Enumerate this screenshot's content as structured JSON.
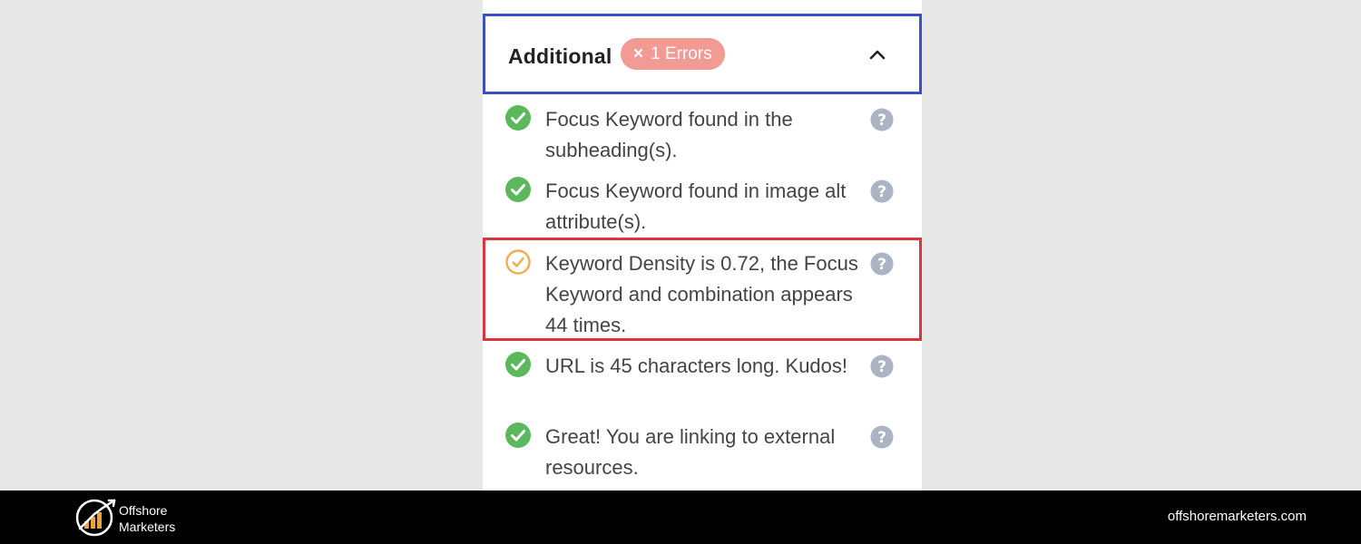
{
  "section": {
    "title": "Additional",
    "badge_x": "×",
    "badge_text": "1 Errors",
    "chevron_icon": "chevron-up-icon"
  },
  "checks": [
    {
      "status": "pass",
      "text": "Focus Keyword found in the subheading(s)."
    },
    {
      "status": "pass",
      "text": "Focus Keyword found in image alt attribute(s)."
    },
    {
      "status": "warning",
      "text": "Keyword Density is 0.72, the Focus Keyword and combination appears 44 times."
    },
    {
      "status": "pass",
      "text": "URL is 45 characters long. Kudos!"
    },
    {
      "status": "pass",
      "text": "Great! You are linking to external resources."
    }
  ],
  "colors": {
    "pass": "#5cb85c",
    "warning": "#f0ad4e",
    "error_badge": "#f29a94",
    "section_border": "#3b4fc8",
    "highlight_border": "#d9363e",
    "help_icon": "#aab4c3"
  },
  "footer": {
    "brand_line1": "Offshore",
    "brand_line2": "Marketers",
    "url": "offshoremarketers.com",
    "logo_icon": "rising-bars-logo-icon"
  }
}
